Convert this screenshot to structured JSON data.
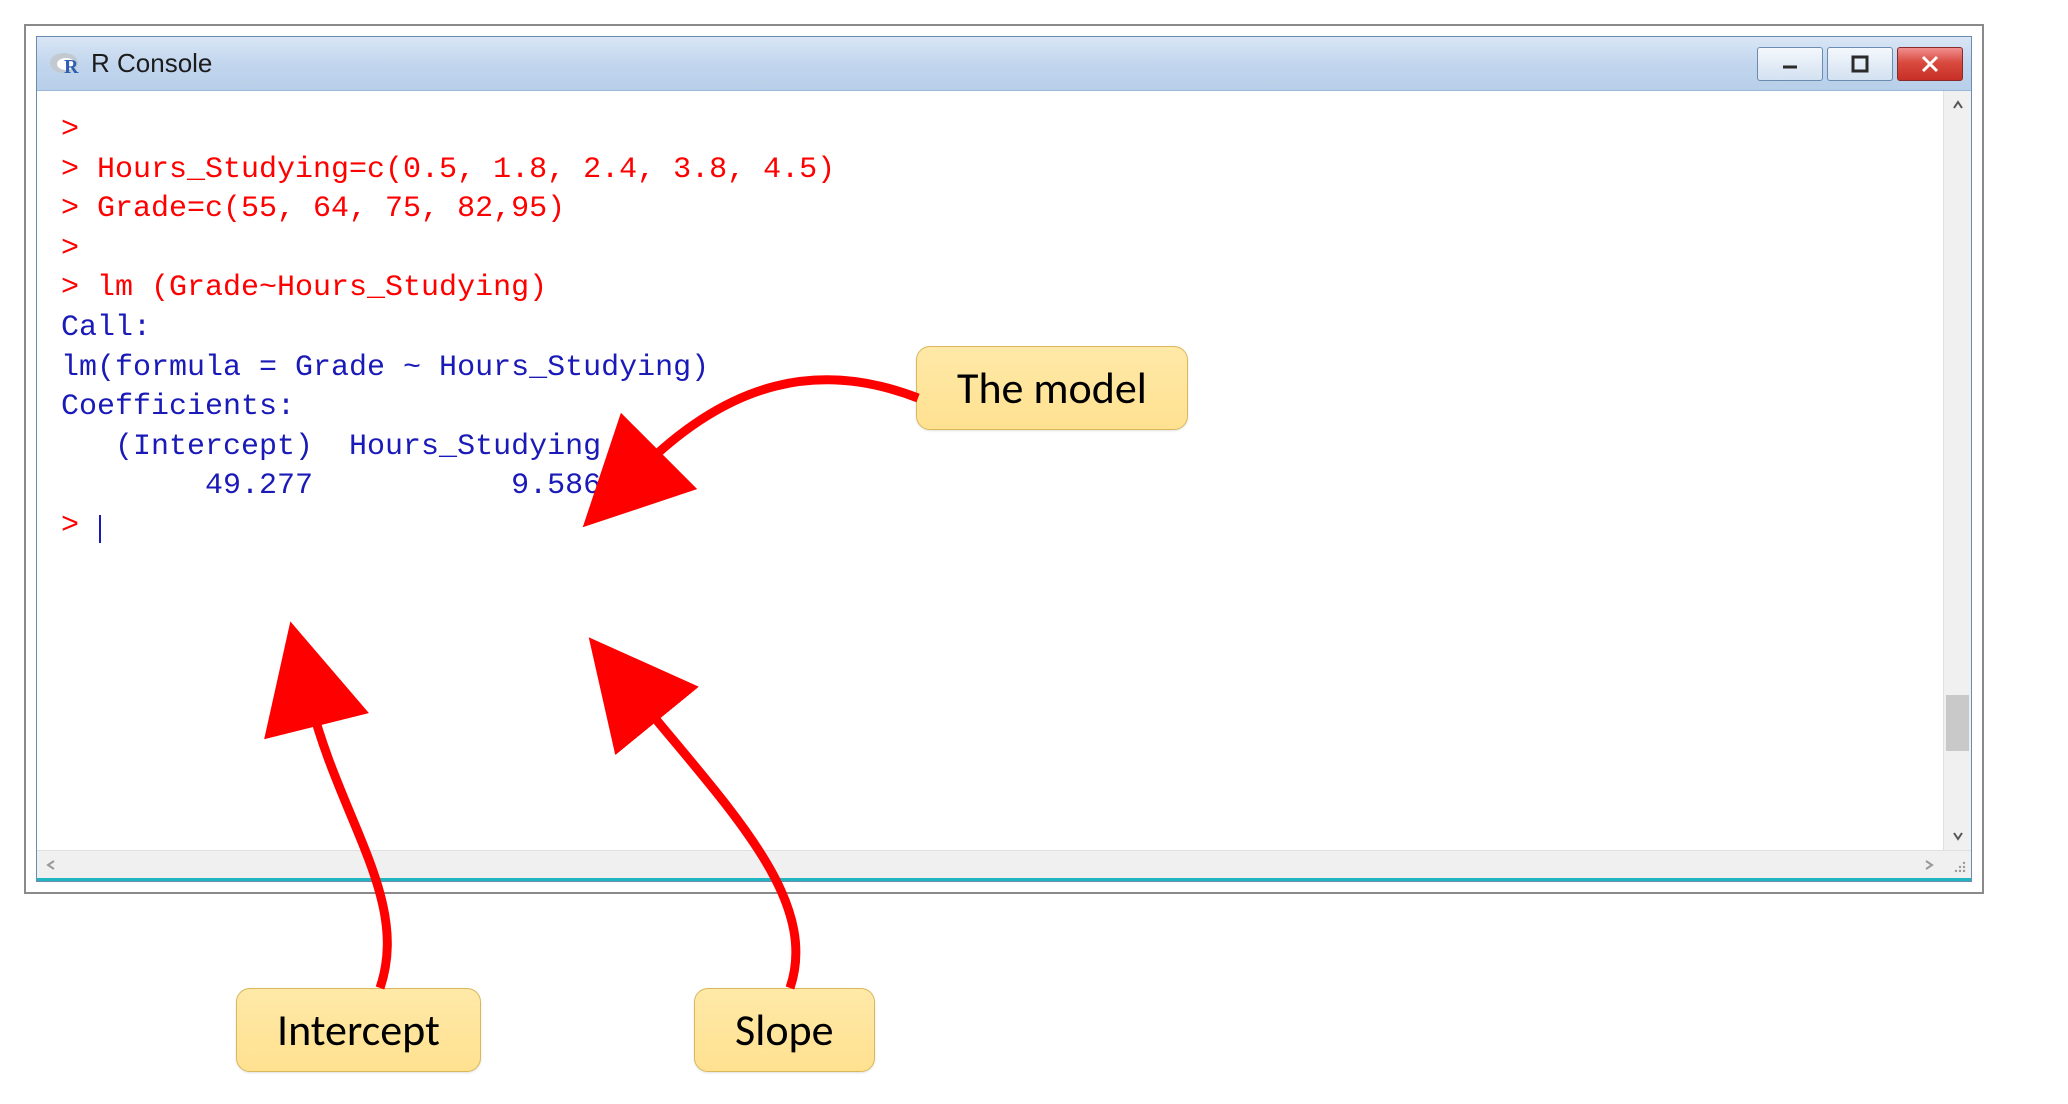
{
  "window": {
    "title": "R Console"
  },
  "console": {
    "lines": [
      {
        "cls": "red",
        "text": ">"
      },
      {
        "cls": "red",
        "text": "> Hours_Studying=c(0.5, 1.8, 2.4, 3.8, 4.5)"
      },
      {
        "cls": "red",
        "text": "> Grade=c(55, 64, 75, 82,95)"
      },
      {
        "cls": "red",
        "text": ">"
      },
      {
        "cls": "red",
        "text": "> lm (Grade~Hours_Studying)"
      },
      {
        "cls": "blue",
        "text": ""
      },
      {
        "cls": "blue",
        "text": "Call:"
      },
      {
        "cls": "blue",
        "text": "lm(formula = Grade ~ Hours_Studying)"
      },
      {
        "cls": "blue",
        "text": ""
      },
      {
        "cls": "blue",
        "text": "Coefficients:"
      },
      {
        "cls": "blue",
        "text": "   (Intercept)  Hours_Studying  "
      },
      {
        "cls": "blue",
        "text": "        49.277           9.586  "
      },
      {
        "cls": "blue",
        "text": ""
      },
      {
        "cls": "red",
        "text": "> ",
        "cursor": true
      }
    ]
  },
  "annotations": {
    "model": "The model",
    "intercept": "Intercept",
    "slope": "Slope"
  }
}
